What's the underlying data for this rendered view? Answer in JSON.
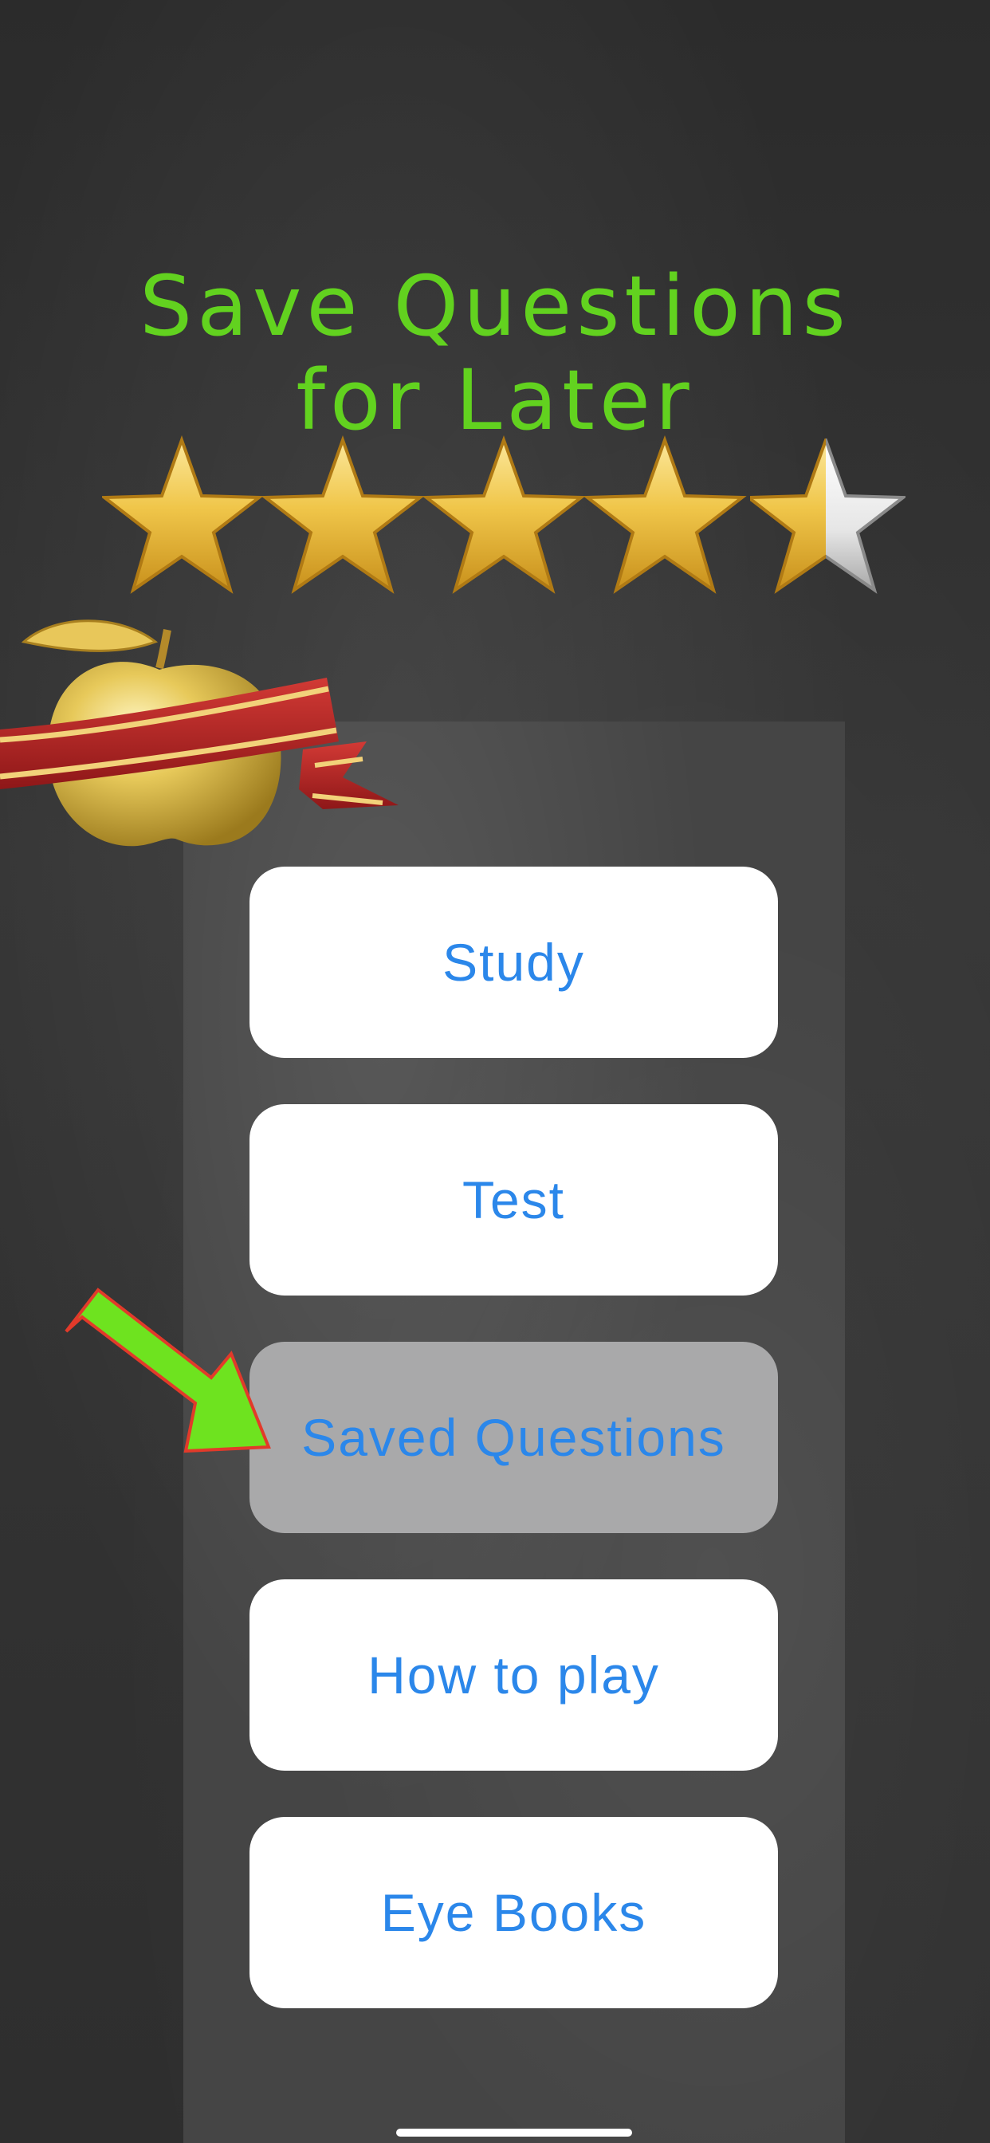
{
  "headline": {
    "line1": "Save Questions",
    "line2": "for Later"
  },
  "rating": {
    "value": 4.5,
    "max": 5
  },
  "menu": {
    "items": [
      {
        "label": "Study",
        "selected": false
      },
      {
        "label": "Test",
        "selected": false
      },
      {
        "label": "Saved Questions",
        "selected": true
      },
      {
        "label": "How to play",
        "selected": false
      },
      {
        "label": "Eye Books",
        "selected": false
      }
    ]
  },
  "icons": {
    "badge": "golden-apple-ribbon-icon",
    "pointer": "arrow-icon",
    "star": "star-icon"
  },
  "colors": {
    "headline": "#62d21f",
    "button_text": "#2b87ea",
    "button_bg": "#ffffff",
    "selected_button_bg": "#a9a9aa",
    "arrow_fill": "#6ee31f",
    "arrow_outline": "#e23a2a",
    "star_gold": "#f0c64a",
    "ribbon_red": "#b52326"
  }
}
